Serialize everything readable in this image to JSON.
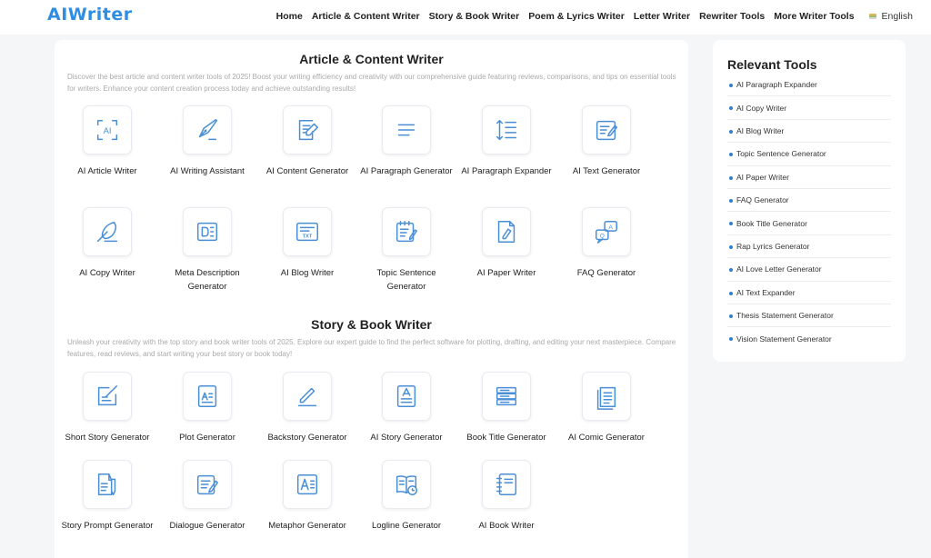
{
  "header": {
    "logo": "AIWriter",
    "nav": [
      "Home",
      "Article & Content Writer",
      "Story & Book Writer",
      "Poem & Lyrics Writer",
      "Letter Writer",
      "Rewriter Tools",
      "More Writer Tools"
    ],
    "language": "English"
  },
  "colors": {
    "accent": "#2f8de4",
    "icon_stroke": "#4a8fd6"
  },
  "sections": [
    {
      "title": "Article & Content Writer",
      "description": "Discover the best article and content writer tools of 2025! Boost your writing efficiency and creativity with our comprehensive guide featuring reviews, comparisons, and tips on essential tools for writers. Enhance your content creation process today and achieve outstanding results!",
      "tools": [
        {
          "label": "AI Article Writer",
          "icon": "ai-scan-icon"
        },
        {
          "label": "AI Writing Assistant",
          "icon": "pen-nib-icon"
        },
        {
          "label": "AI Content Generator",
          "icon": "document-edit-icon"
        },
        {
          "label": "AI Paragraph Generator",
          "icon": "paragraph-lines-icon"
        },
        {
          "label": "AI Paragraph Expander",
          "icon": "expand-lines-icon"
        },
        {
          "label": "AI Text Generator",
          "icon": "text-edit-icon"
        },
        {
          "label": "AI Copy Writer",
          "icon": "feather-icon"
        },
        {
          "label": "Meta Description Generator",
          "icon": "description-card-icon"
        },
        {
          "label": "AI Blog Writer",
          "icon": "txt-window-icon"
        },
        {
          "label": "Topic Sentence Generator",
          "icon": "notepad-pencil-icon"
        },
        {
          "label": "AI Paper Writer",
          "icon": "paper-quill-icon"
        },
        {
          "label": "FAQ Generator",
          "icon": "qa-bubbles-icon"
        }
      ]
    },
    {
      "title": "Story & Book Writer",
      "description": "Unleash your creativity with the top story and book writer tools of 2025. Explore our expert guide to find the perfect software for plotting, drafting, and editing your next masterpiece. Compare features, read reviews, and start writing your best story or book today!",
      "tools": [
        {
          "label": "Short Story Generator",
          "icon": "edit-square-icon"
        },
        {
          "label": "Plot Generator",
          "icon": "plot-card-icon"
        },
        {
          "label": "Backstory Generator",
          "icon": "pencil-line-icon"
        },
        {
          "label": "AI Story Generator",
          "icon": "story-document-icon"
        },
        {
          "label": "Book Title Generator",
          "icon": "book-stack-icon"
        },
        {
          "label": "AI Comic Generator",
          "icon": "comic-pages-icon"
        },
        {
          "label": "Story Prompt Generator",
          "icon": "prompt-pen-icon"
        },
        {
          "label": "Dialogue Generator",
          "icon": "dialogue-pencil-icon"
        },
        {
          "label": "Metaphor Generator",
          "icon": "metaphor-a-icon"
        },
        {
          "label": "Logline Generator",
          "icon": "book-clock-icon"
        },
        {
          "label": "AI Book Writer",
          "icon": "notebook-icon"
        }
      ]
    }
  ],
  "sidebar": {
    "title": "Relevant Tools",
    "items": [
      "AI Paragraph Expander",
      "AI Copy Writer",
      "AI Blog Writer",
      "Topic Sentence Generator",
      "AI Paper Writer",
      "FAQ Generator",
      "Book Title Generator",
      "Rap Lyrics Generator",
      "AI Love Letter Generator",
      "AI Text Expander",
      "Thesis Statement Generator",
      "Vision Statement Generator"
    ]
  }
}
